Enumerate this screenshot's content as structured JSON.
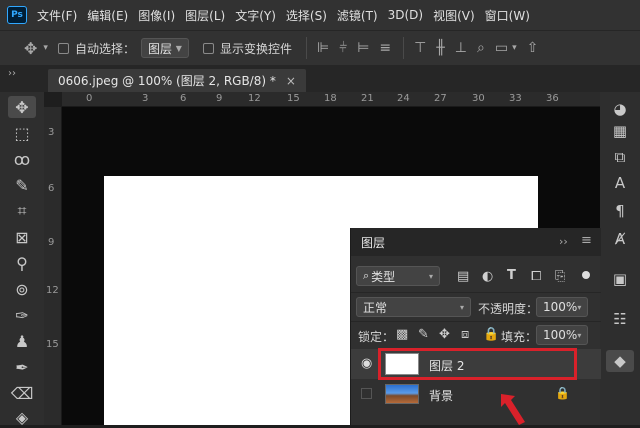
{
  "app": {
    "logo": "Ps"
  },
  "menu": [
    "文件(F)",
    "编辑(E)",
    "图像(I)",
    "图层(L)",
    "文字(Y)",
    "选择(S)",
    "滤镜(T)",
    "3D(D)",
    "视图(V)",
    "窗口(W)"
  ],
  "options": {
    "auto_select_label": "自动选择：",
    "auto_select_value": "图层",
    "show_transform_label": "显示变换控件"
  },
  "tab": {
    "title": "0606.jpeg @ 100% (图层 2, RGB/8) *",
    "close": "×",
    "collapse": "››"
  },
  "ruler": {
    "h": [
      "0",
      "3",
      "6",
      "9",
      "12",
      "15",
      "18",
      "21",
      "24",
      "27",
      "30",
      "33",
      "36"
    ],
    "v": [
      "3",
      "6",
      "9",
      "12",
      "15"
    ]
  },
  "layers_panel": {
    "title": "图层",
    "collapse": "››",
    "filter_label": "类型",
    "blend_mode": "正常",
    "opacity_label": "不透明度：",
    "opacity_value": "100%",
    "lock_label": "锁定：",
    "fill_label": "填充：",
    "fill_value": "100%",
    "layers": [
      {
        "name": "图层 2",
        "visible": true,
        "selected": true
      },
      {
        "name": "背景",
        "visible": false,
        "locked": true
      }
    ]
  },
  "colors": {
    "highlight": "#d9212a",
    "panel": "#303030",
    "menubar": "#323232"
  }
}
